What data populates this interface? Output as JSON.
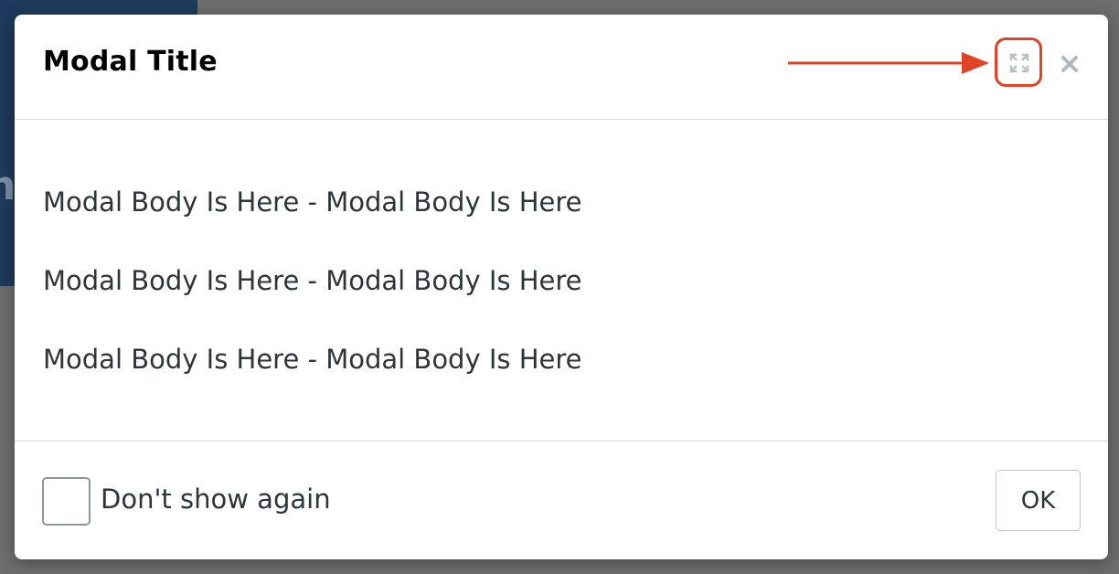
{
  "background": {
    "partial_text": "ns"
  },
  "modal": {
    "title": "Modal Title",
    "maximize_icon": "maximize-icon",
    "close_icon": "close-icon",
    "annotation_color": "#e04326",
    "body_lines": [
      "Modal Body Is Here - Modal Body Is Here",
      "Modal Body Is Here - Modal Body Is Here",
      "Modal Body Is Here - Modal Body Is Here"
    ],
    "footer": {
      "checkbox_label": "Don't show again",
      "checkbox_checked": false,
      "ok_label": "OK"
    }
  }
}
